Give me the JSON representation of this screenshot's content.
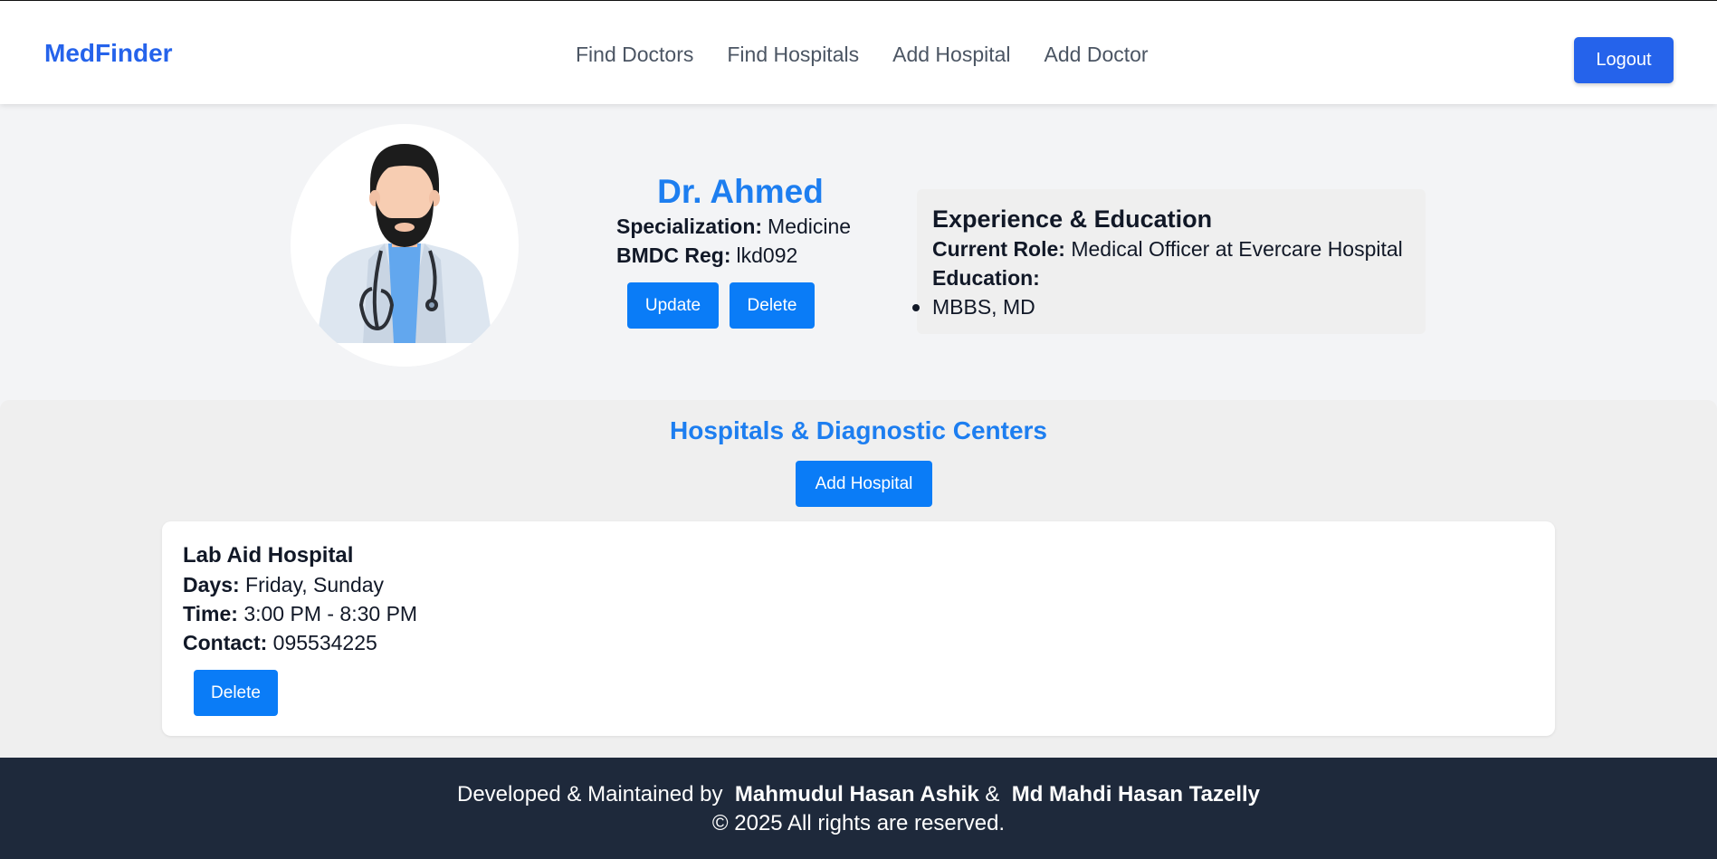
{
  "navbar": {
    "brand": "MedFinder",
    "links": [
      "Find Doctors",
      "Find Hospitals",
      "Add Hospital",
      "Add Doctor"
    ],
    "logout_label": "Logout"
  },
  "doctor": {
    "name": "Dr. Ahmed",
    "specialization_label": "Specialization:",
    "specialization": "Medicine",
    "bmdc_label": "BMDC Reg:",
    "bmdc": "lkd092",
    "update_label": "Update",
    "delete_label": "Delete",
    "avatar_icon": "doctor-avatar-icon"
  },
  "experience": {
    "title": "Experience & Education",
    "current_role_label": "Current Role:",
    "current_role": "Medical Officer at Evercare Hospital",
    "education_label": "Education:",
    "education": [
      "MBBS, MD"
    ]
  },
  "hospitals": {
    "title": "Hospitals & Diagnostic Centers",
    "add_label": "Add Hospital",
    "items": [
      {
        "name": "Lab Aid Hospital",
        "days_label": "Days:",
        "days": "Friday, Sunday",
        "time_label": "Time:",
        "time": "3:00 PM - 8:30 PM",
        "contact_label": "Contact:",
        "contact": "095534225",
        "delete_label": "Delete"
      }
    ]
  },
  "footer": {
    "developed_by": "Developed & Maintained by",
    "dev1": "Mahmudul Hasan Ashik",
    "and": "&",
    "dev2": "Md Mahdi Hasan Tazelly",
    "copyright": "© 2025 All rights are reserved."
  },
  "colors": {
    "brand": "#2563eb",
    "accent": "#0a7cf7",
    "heading_blue": "#1d7ef0",
    "footer_bg": "#1e293b",
    "page_bg": "#f3f4f6"
  }
}
